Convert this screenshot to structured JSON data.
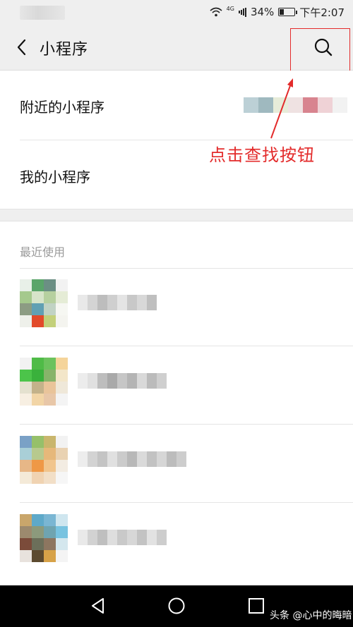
{
  "status_bar": {
    "network": "4G",
    "battery": "34%",
    "battery_level": 0.34,
    "time": "下午2:07"
  },
  "header": {
    "title": "小程序"
  },
  "menu": [
    {
      "label": "附近的小程序"
    },
    {
      "label": "我的小程序"
    }
  ],
  "annotation": {
    "text": "点击查找按钮",
    "color": "#e32b2b"
  },
  "recent": {
    "section_label": "最近使用"
  },
  "watermark": {
    "text": "头条 @心中的晦暗"
  },
  "icons": {
    "back": "chevron-left-icon",
    "search": "search-icon",
    "nav_back": "triangle-back-icon",
    "nav_home": "circle-home-icon",
    "nav_recents": "square-recents-icon"
  }
}
